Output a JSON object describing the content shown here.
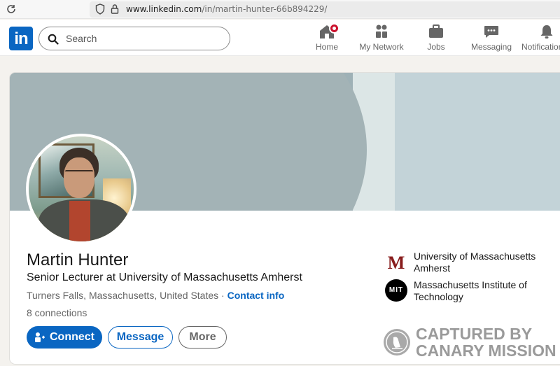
{
  "browser": {
    "url_host": "www.linkedin.com",
    "url_path": "/in/martin-hunter-66b894229/"
  },
  "nav": {
    "logo_text": "in",
    "search_placeholder": "Search",
    "items": [
      {
        "label": "Home",
        "icon": "home-icon"
      },
      {
        "label": "My Network",
        "icon": "network-icon"
      },
      {
        "label": "Jobs",
        "icon": "briefcase-icon"
      },
      {
        "label": "Messaging",
        "icon": "message-icon"
      },
      {
        "label": "Notifications",
        "icon": "bell-icon"
      }
    ],
    "accent": "#0a66c2",
    "badge_color": "#cb112d"
  },
  "profile": {
    "name": "Martin Hunter",
    "headline": "Senior Lecturer at University of Massachusetts Amherst",
    "location": "Turners Falls, Massachusetts, United States",
    "separator": " · ",
    "contact_info": "Contact info",
    "connections": "8 connections",
    "actions": {
      "connect": "Connect",
      "message": "Message",
      "more": "More"
    },
    "organizations": [
      {
        "name": "University of Massachusetts Amherst",
        "logo_text": "M",
        "color": "#881c1c"
      },
      {
        "name": "Massachusetts Institute of Technology",
        "logo_text": "MIT",
        "color": "#000000"
      }
    ]
  },
  "watermark": {
    "line1": "CAPTURED BY",
    "line2": "CANARY MISSION"
  }
}
